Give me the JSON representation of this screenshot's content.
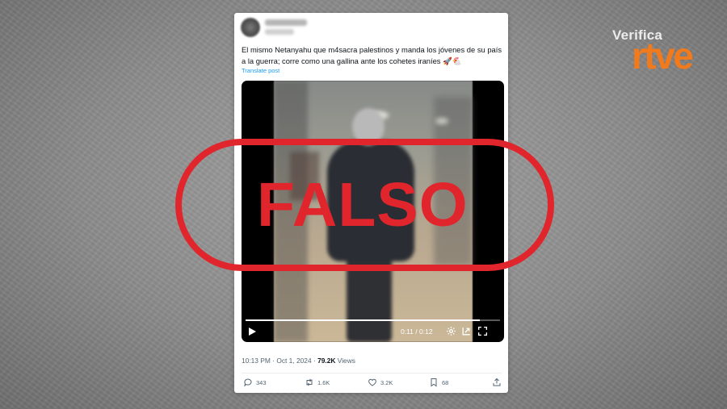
{
  "brand": {
    "line1": "Verifica",
    "line2": "rtve"
  },
  "tweet": {
    "text": "El mismo Netanyahu que m4sacra palestinos y manda los jóvenes de su país a la guerra; corre como una gallina ante los cohetes iraníes 🚀🐔",
    "translate_label": "Translate post",
    "time": "10:13 PM",
    "date": "Oct 1, 2024",
    "views_count": "79.2K",
    "views_label": "Views",
    "replies": "343",
    "reposts": "1.6K",
    "likes": "3.2K",
    "bookmarks": "68"
  },
  "video": {
    "time_display": "0:11 / 0:12",
    "progress": 0.92
  },
  "stamp": {
    "text": "FALSO",
    "color": "#e0262c"
  },
  "colors": {
    "brand_orange": "#f07a1c",
    "link_blue": "#1d9bf0",
    "muted": "#536471"
  }
}
